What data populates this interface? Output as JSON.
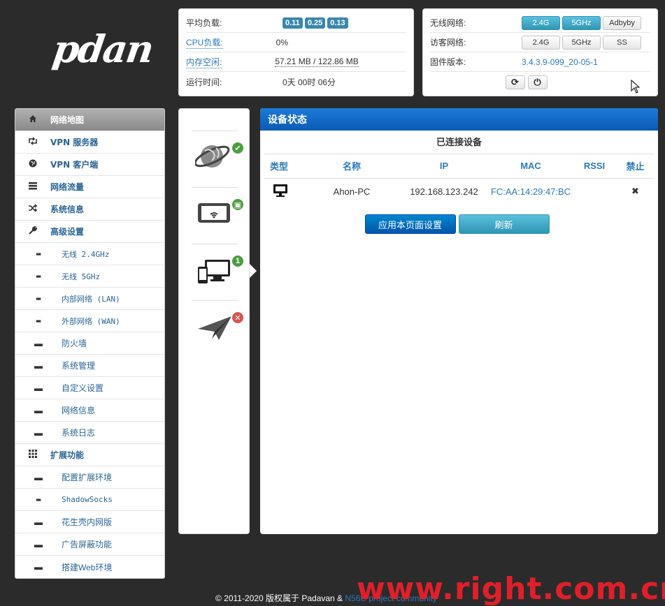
{
  "logo": "pdan",
  "status": {
    "load_label": "平均负载:",
    "load_values": [
      "0.11",
      "0.25",
      "0.13"
    ],
    "cpu_label": "CPU负载:",
    "cpu_value": "0%",
    "mem_label": "内存空闲:",
    "mem_value": "57.21 MB / 122.86 MB",
    "uptime_label": "运行时间:",
    "uptime_value": "0天 00时 06分"
  },
  "wireless": {
    "wifi_label": "无线网络:",
    "wifi_buttons": [
      "2.4G",
      "5GHz",
      "Adbyby"
    ],
    "guest_label": "访客网络:",
    "guest_buttons": [
      "2.4G",
      "5GHz",
      "SS"
    ],
    "fw_label": "固件版本:",
    "fw_value": "3.4.3.9-099_20-05-1",
    "refresh_glyph": "⟳",
    "power_glyph": "⏻"
  },
  "sidebar": {
    "items": [
      {
        "label": "网络地图",
        "icon": "home-icon"
      },
      {
        "label": "VPN 服务器",
        "icon": "retweet-icon"
      },
      {
        "label": "VPN 客户端",
        "icon": "globe-icon"
      },
      {
        "label": "网络流量",
        "icon": "tasks-icon"
      },
      {
        "label": "系统信息",
        "icon": "random-icon"
      },
      {
        "label": "高级设置",
        "icon": "wrench-icon"
      }
    ],
    "advanced": [
      "无线 2.4GHz",
      "无线 5GHz",
      "内部网络 (LAN)",
      "外部网络 (WAN)",
      "防火墙",
      "系统管理",
      "自定义设置",
      "网络信息",
      "系统日志"
    ],
    "ext_label": "扩展功能",
    "extensions": [
      "配置扩展环境",
      "ShadowSocks",
      "花生壳内网版",
      "广告屏蔽功能",
      "搭建Web环境"
    ]
  },
  "iconcol": {
    "badge_count": "1"
  },
  "main": {
    "title": "设备状态",
    "subtitle": "已连接设备",
    "columns": [
      "类型",
      "名称",
      "IP",
      "MAC",
      "RSSI",
      "禁止"
    ],
    "rows": [
      {
        "name": "Ahon-PC",
        "ip": "192.168.123.242",
        "mac": "FC:AA:14:29:47:BC",
        "rssi": "",
        "block": "✖"
      }
    ],
    "apply_button": "应用本页面设置",
    "refresh_button": "刷新"
  },
  "footer": {
    "text": "© 2011-2020 版权属于 Padavan & ",
    "link": "N56U project community"
  },
  "watermark": "www.right.com.cn"
}
